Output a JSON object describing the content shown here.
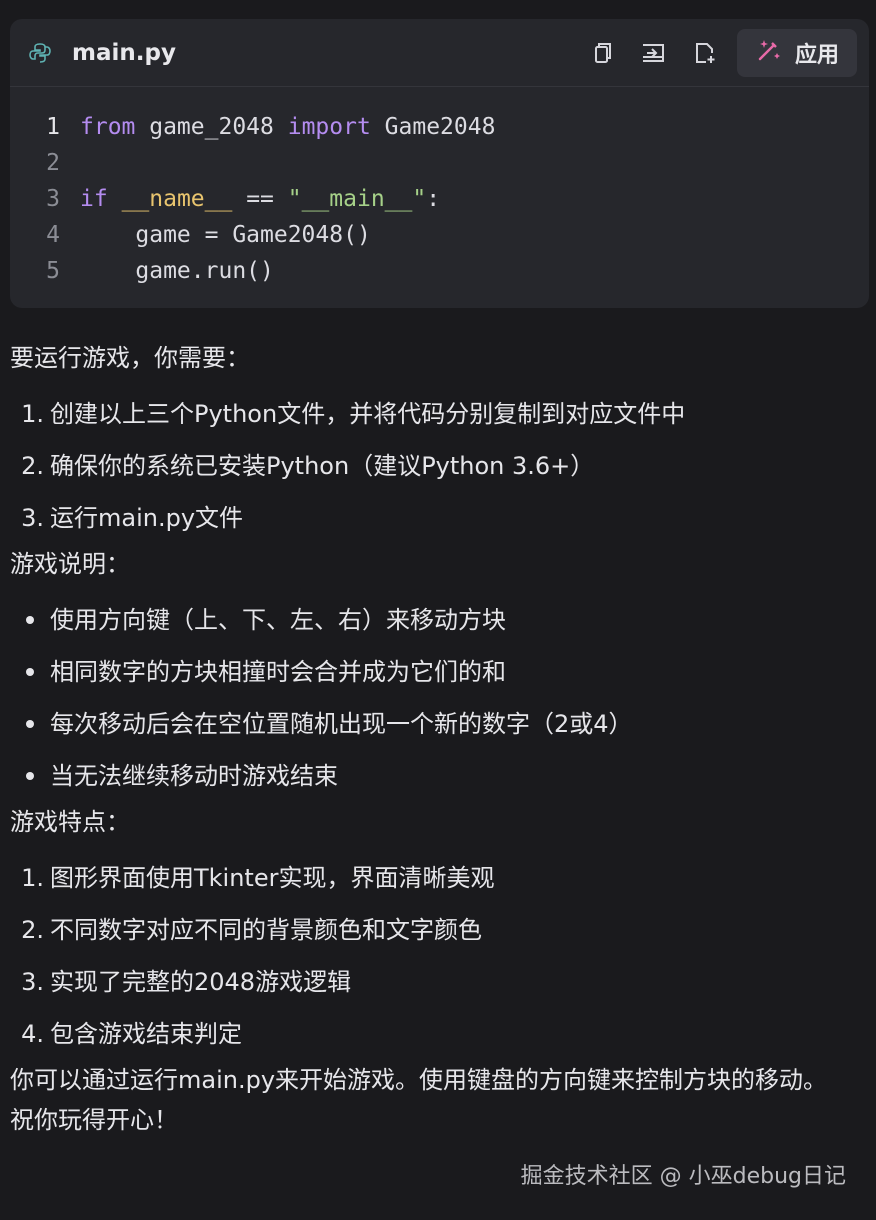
{
  "code_block": {
    "filename": "main.py",
    "apply_label": "应用",
    "icons": [
      "python-file-icon",
      "copy-icon",
      "insert-icon",
      "new-file-icon",
      "magic-wand-icon"
    ],
    "lines": [
      {
        "num": "1",
        "tokens": [
          [
            "kw",
            "from"
          ],
          [
            "plain",
            " game_2048 "
          ],
          [
            "kw",
            "import"
          ],
          [
            "plain",
            " Game2048"
          ]
        ]
      },
      {
        "num": "2",
        "tokens": []
      },
      {
        "num": "3",
        "tokens": [
          [
            "kw",
            "if"
          ],
          [
            "plain",
            " "
          ],
          [
            "dunder",
            "__name__"
          ],
          [
            "plain",
            " == "
          ],
          [
            "str",
            "\"__main__\""
          ],
          [
            "plain",
            ":"
          ]
        ]
      },
      {
        "num": "4",
        "tokens": [
          [
            "plain",
            "    game = Game2048()"
          ]
        ]
      },
      {
        "num": "5",
        "tokens": [
          [
            "plain",
            "    game.run()"
          ]
        ]
      }
    ]
  },
  "intro": "要运行游戏，你需要：",
  "run_steps": [
    "创建以上三个Python文件，并将代码分别复制到对应文件中",
    "确保你的系统已安装Python（建议Python 3.6+）",
    "运行main.py文件"
  ],
  "instructions_heading": "游戏说明：",
  "instructions": [
    "使用方向键（上、下、左、右）来移动方块",
    "相同数字的方块相撞时会合并成为它们的和",
    "每次移动后会在空位置随机出现一个新的数字（2或4）",
    "当无法继续移动时游戏结束"
  ],
  "features_heading": "游戏特点：",
  "features": [
    "图形界面使用Tkinter实现，界面清晰美观",
    "不同数字对应不同的背景颜色和文字颜色",
    "实现了完整的2048游戏逻辑",
    "包含游戏结束判定"
  ],
  "closing": "你可以通过运行main.py来开始游戏。使用键盘的方向键来控制方块的移动。祝你玩得开心！",
  "watermark": "掘金技术社区 @ 小巫debug日记"
}
